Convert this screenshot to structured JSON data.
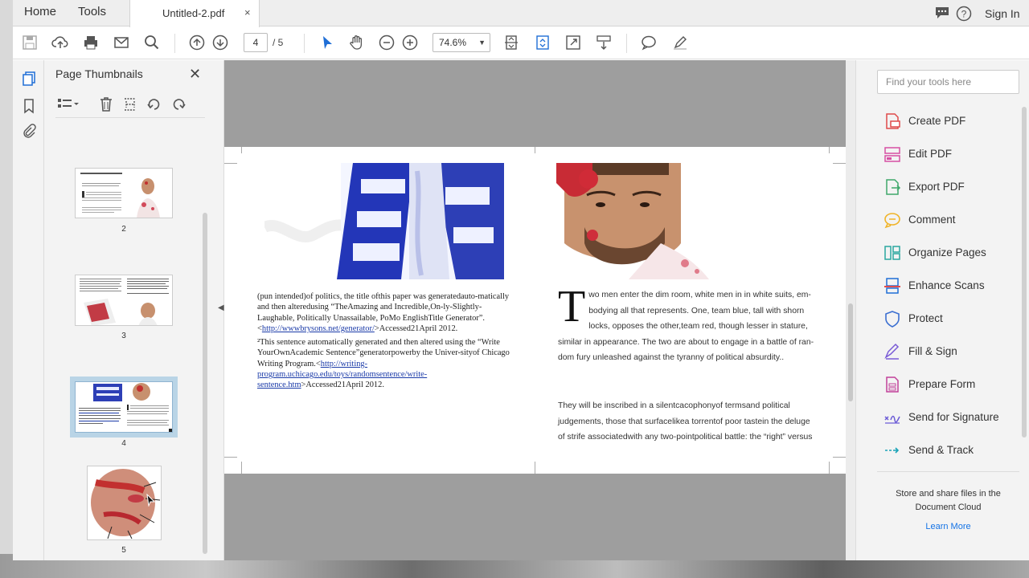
{
  "nav": {
    "home": "Home",
    "tools": "Tools"
  },
  "document_tab": {
    "title": "Untitled-2.pdf",
    "close": "×"
  },
  "account": {
    "sign_in": "Sign In"
  },
  "toolbar": {
    "page_current": "4",
    "page_total": "/ 5",
    "zoom": "74.6%"
  },
  "thumbnails": {
    "title": "Page Thumbnails",
    "pages": [
      "2",
      "3",
      "4",
      "5"
    ],
    "selected": "4"
  },
  "document": {
    "left_column": {
      "para1": "(pun intended)of politics, the title ofthis paper was generatedauto-matically and then alteredusing “TheAmazing and Incredible,On-ly-Slightly-Laughable, Politically Unassailable, PoMo EnglishTitle Generator”.  <",
      "link1": "http://wwwbrysons.net/generator/",
      "para1_end": ">Accessed21April 2012.",
      "para2": "²This sentence automatically generated and then altered using the “Write YourOwnAcademic Sentence”generatorpowerby the Univer-sityof Chicago Writing Program.<",
      "link2": "http://writing-program.uchicago.edu/toys/randomsentence/write-sentence.htm",
      "para2_end": ">Accessed21April 2012."
    },
    "right_column": {
      "dropcap": "T",
      "para1": "wo men enter the dim room, white men in in white suits, em-bodying all that represents. One, team blue, tall with shorn locks, opposes the other,team red, though lesser in stature, similar in appearance. The two are about to engage in a battle of ran-dom fury unleashed against the tyranny of political absurdity..",
      "para2": "They will be inscribed in a silentcacophonyof termsand political judgements, those that surfacelikea torrentof poor tastein the deluge of strife associatedwith any two-pointpolitical battle: the “right” versus"
    }
  },
  "tools_pane": {
    "search_placeholder": "Find your tools here",
    "items": [
      {
        "label": "Create PDF",
        "color": "#e04b4b"
      },
      {
        "label": "Edit PDF",
        "color": "#d64fa3"
      },
      {
        "label": "Export PDF",
        "color": "#3fa86b"
      },
      {
        "label": "Comment",
        "color": "#f0b429"
      },
      {
        "label": "Organize Pages",
        "color": "#2aa7a0"
      },
      {
        "label": "Enhance Scans",
        "color": "#e04b4b"
      },
      {
        "label": "Protect",
        "color": "#3b6fd1"
      },
      {
        "label": "Fill & Sign",
        "color": "#7a5bd6"
      },
      {
        "label": "Prepare Form",
        "color": "#c2419a"
      },
      {
        "label": "Send for Signature",
        "color": "#6b5bd6"
      },
      {
        "label": "Send & Track",
        "color": "#1aa3b8"
      }
    ],
    "store_text": "Store and share files in the Document Cloud",
    "learn_more": "Learn More"
  }
}
